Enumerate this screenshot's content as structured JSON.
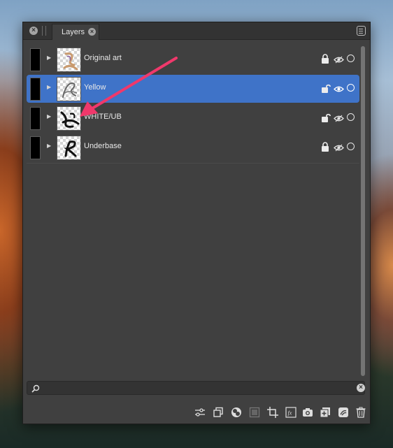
{
  "panel": {
    "tab_label": "Layers"
  },
  "layers": [
    {
      "name": "Original art",
      "locked": true,
      "selected": false
    },
    {
      "name": "Yellow",
      "locked": false,
      "selected": true
    },
    {
      "name": "WHITE/UB",
      "locked": false,
      "selected": false
    },
    {
      "name": "Underbase",
      "locked": true,
      "selected": false
    }
  ],
  "search": {
    "value": "",
    "placeholder": ""
  },
  "toolbar": {
    "buttons": [
      "adjustments-icon",
      "duplicate-icon",
      "blend-ranges-icon",
      "mask-icon",
      "crop-icon",
      "fx-icon",
      "snapshot-camera-icon",
      "add-layer-icon",
      "add-pixel-layer-icon",
      "trash-icon"
    ]
  },
  "colors": {
    "selection": "#3f73c8",
    "annotation_arrow": "#f0386b",
    "panel_bg": "#404040"
  }
}
